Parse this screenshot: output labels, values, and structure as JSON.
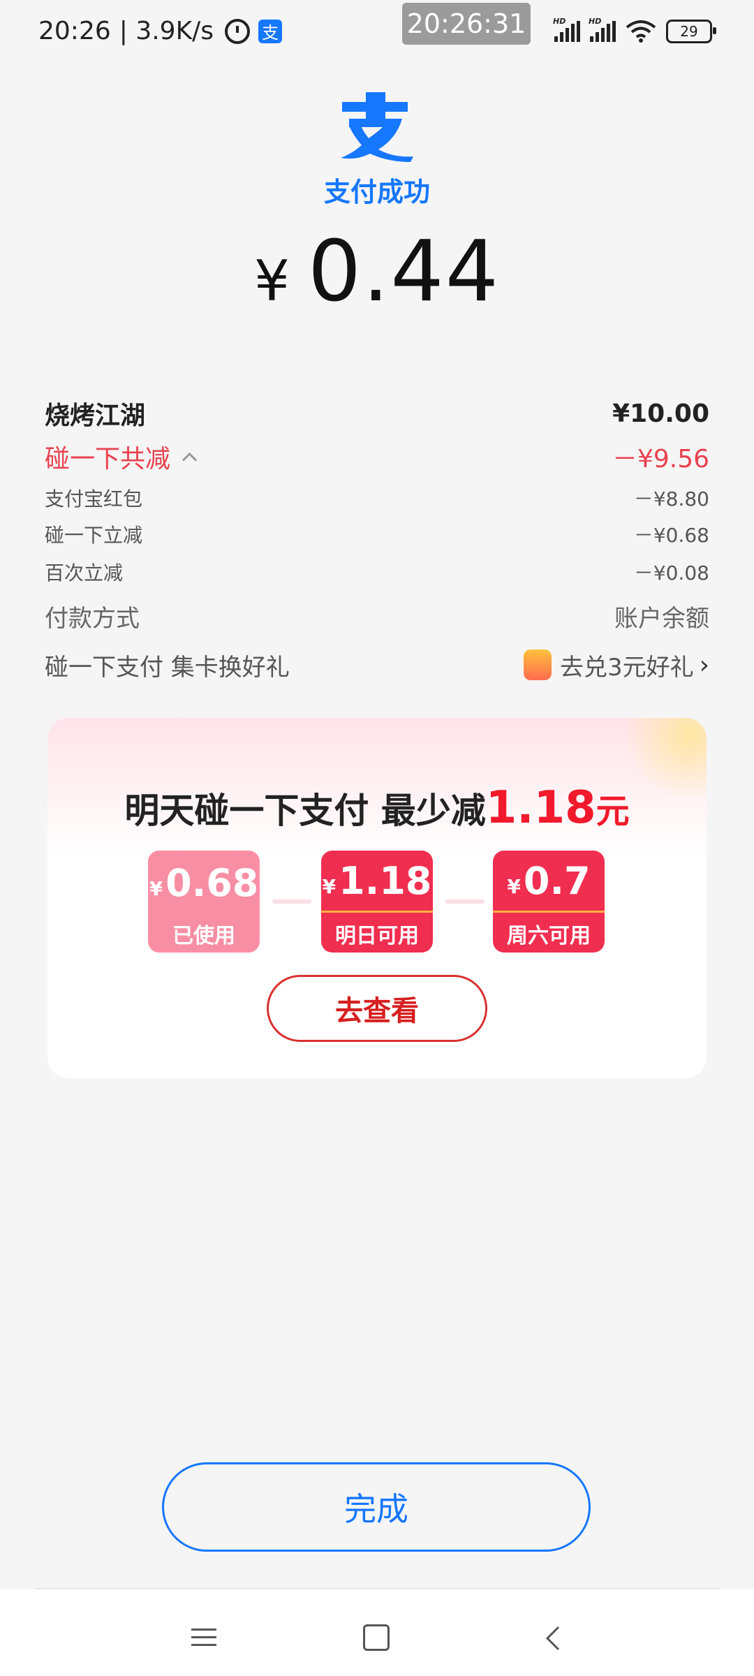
{
  "status_bar": {
    "time": "20:26",
    "speed": "| 3.9K/s",
    "alarm_icon": "alarm-icon",
    "app_icon_char": "支",
    "overlay_clock": "20:26:31",
    "signal_1_label": "HD",
    "signal_2_label": "HD",
    "battery": "29"
  },
  "header": {
    "logo_icon": "alipay-logo-icon",
    "title": "支付成功",
    "amount_symbol": "¥",
    "amount_value": "0.44"
  },
  "details": {
    "merchant": {
      "label": "烧烤江湖",
      "value": "¥10.00"
    },
    "total_discount": {
      "label": "碰一下共减",
      "value": "－¥9.56"
    },
    "items": [
      {
        "label": "支付宝红包",
        "value": "－¥8.80"
      },
      {
        "label": "碰一下立减",
        "value": "－¥0.68"
      },
      {
        "label": "百次立减",
        "value": "－¥0.08"
      }
    ],
    "method": {
      "label": "付款方式",
      "value": "账户余额"
    },
    "promo": {
      "label": "碰一下支付 集卡换好礼",
      "value": "去兑3元好礼"
    }
  },
  "card": {
    "heading_prefix": "明天碰一下支付 最少减",
    "heading_amount": "1.18",
    "heading_unit": "元",
    "coupons": [
      {
        "symbol": "¥",
        "amount": "0.68",
        "label": "已使用"
      },
      {
        "symbol": "¥",
        "amount": "1.18",
        "label": "明日可用"
      },
      {
        "symbol": "¥",
        "amount": "0.7",
        "label": "周六可用"
      }
    ],
    "check_button": "去查看"
  },
  "done_button": "完成",
  "colors": {
    "brand_blue": "#1677ff",
    "discount_red": "#e8414e",
    "coupon_red": "#f02e50",
    "background": "#f5f5f5"
  }
}
